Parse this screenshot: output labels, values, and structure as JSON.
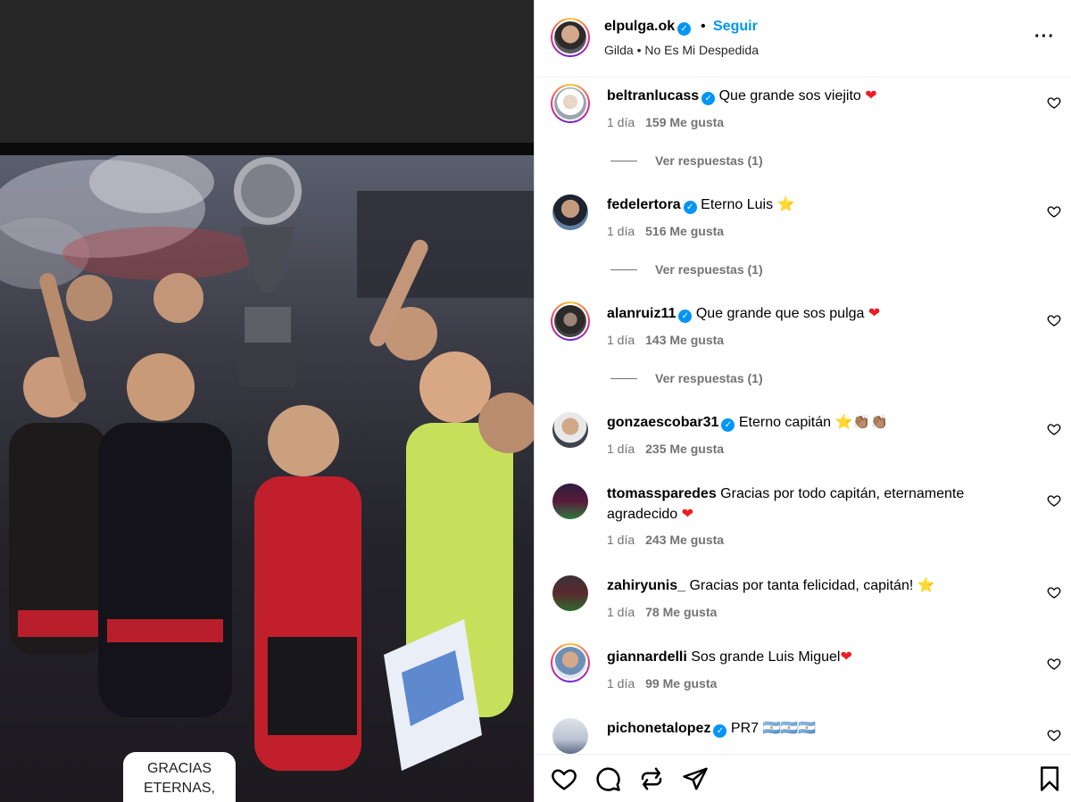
{
  "media": {
    "caption_lines": [
      "GRACIAS",
      "ETERNAS,"
    ]
  },
  "header": {
    "username": "elpulga.ok",
    "separator": "•",
    "follow_label": "Seguir",
    "song": "Gilda • No Es Mi Despedida",
    "more_label": "···"
  },
  "comments": [
    {
      "user": "beltranlucass",
      "verified": true,
      "text": "Que grande sos viejito ",
      "emoji": "❤",
      "emoji_type": "heart",
      "time": "1 día",
      "likes": "159 Me gusta",
      "replies": "Ver respuestas (1)"
    },
    {
      "user": "fedelertora",
      "verified": true,
      "text": "Eterno Luis ",
      "emoji": "⭐",
      "emoji_type": "star",
      "time": "1 día",
      "likes": "516 Me gusta",
      "replies": "Ver respuestas (1)"
    },
    {
      "user": "alanruiz11",
      "verified": true,
      "text": "Que grande que sos pulga ",
      "emoji": "❤",
      "emoji_type": "heart",
      "time": "1 día",
      "likes": "143 Me gusta",
      "replies": "Ver respuestas (1)"
    },
    {
      "user": "gonzaescobar31",
      "verified": true,
      "text": "Eterno capitán ",
      "emoji": "⭐👏🏽👏🏽",
      "emoji_type": "star",
      "time": "1 día",
      "likes": "235 Me gusta",
      "replies": ""
    },
    {
      "user": "ttomassparedes",
      "verified": false,
      "text": "Gracias por todo capitán, eternamente agradecido ",
      "emoji": "❤",
      "emoji_type": "heart",
      "time": "1 día",
      "likes": "243 Me gusta",
      "replies": ""
    },
    {
      "user": "zahiryunis_",
      "verified": false,
      "text": "Gracias por tanta felicidad, capitán! ",
      "emoji": "⭐",
      "emoji_type": "star",
      "time": "1 día",
      "likes": "78 Me gusta",
      "replies": ""
    },
    {
      "user": "giannardelli",
      "verified": false,
      "text": "Sos grande Luis Miguel",
      "emoji": "❤",
      "emoji_type": "heart",
      "time": "1 día",
      "likes": "99 Me gusta",
      "replies": ""
    },
    {
      "user": "pichonetalopez",
      "verified": true,
      "text": "PR7 ",
      "emoji": "🇦🇷🇦🇷🇦🇷",
      "emoji_type": "flag",
      "time": "",
      "likes": "",
      "replies": ""
    }
  ],
  "colors": {
    "accent": "#0095f6",
    "muted": "#737373",
    "heart": "#ed1c24"
  }
}
